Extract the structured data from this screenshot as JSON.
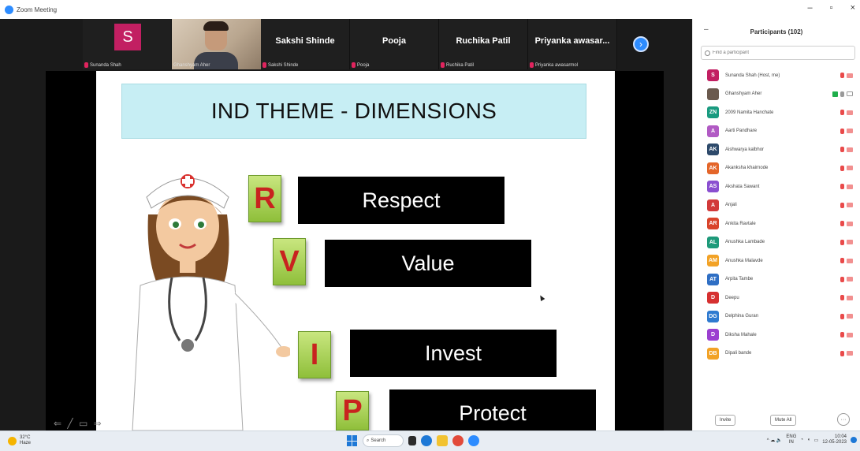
{
  "window": {
    "title": "Zoom Meeting",
    "controls": [
      "–",
      "▫",
      "×"
    ]
  },
  "video_strip": {
    "tiles": [
      {
        "type": "avatar",
        "initial": "S",
        "label": "Sunanda Shah"
      },
      {
        "type": "video",
        "label": "Ghanshyam Aher"
      },
      {
        "type": "name",
        "name": "Sakshi Shinde",
        "label": "Sakshi Shinde"
      },
      {
        "type": "name",
        "name": "Pooja",
        "label": "Pooja"
      },
      {
        "type": "name",
        "name": "Ruchika Patil",
        "label": "Ruchika Patil"
      },
      {
        "type": "name",
        "name": "Priyanka awasar...",
        "label": "Priyanka awasarmol"
      }
    ],
    "next_icon": "›"
  },
  "slide": {
    "title": "IND THEME - DIMENSIONS",
    "items": [
      {
        "letter": "R",
        "word": "Respect"
      },
      {
        "letter": "V",
        "word": "Value"
      },
      {
        "letter": "I",
        "word": "Invest"
      },
      {
        "letter": "P",
        "word": "Protect"
      }
    ],
    "tools": "⇐ ╱ ▭ ⇒"
  },
  "participants": {
    "collapse_icon": "–",
    "title": "Participants (102)",
    "search_placeholder": "Find a participant",
    "list": [
      {
        "initials": "S",
        "name": "Sunanda Shah (Host, me)",
        "color": "#c21f62",
        "status": "muted"
      },
      {
        "initials": "",
        "name": "Ghanshyam Aher",
        "color": "#6b5a4e",
        "status": "active"
      },
      {
        "initials": "ZN",
        "name": "2009 Namita Hanchate",
        "color": "#1a9b80",
        "status": "muted"
      },
      {
        "initials": "A",
        "name": "Aarti Pandhare",
        "color": "#b15ac4",
        "status": "muted"
      },
      {
        "initials": "AK",
        "name": "Aishwarya kalbhor",
        "color": "#2e4a6b",
        "status": "muted"
      },
      {
        "initials": "AK",
        "name": "Akanksha khairnode",
        "color": "#e4662a",
        "status": "muted"
      },
      {
        "initials": "AS",
        "name": "Akshata Sawant",
        "color": "#8a4fd0",
        "status": "muted"
      },
      {
        "initials": "A",
        "name": "Anjali",
        "color": "#d23a3a",
        "status": "muted"
      },
      {
        "initials": "AR",
        "name": "Ankita Ravtale",
        "color": "#d9442b",
        "status": "muted"
      },
      {
        "initials": "AL",
        "name": "Anushka Lambade",
        "color": "#1e9a7a",
        "status": "muted"
      },
      {
        "initials": "AM",
        "name": "Anushka Malavde",
        "color": "#f2a226",
        "status": "muted"
      },
      {
        "initials": "AT",
        "name": "Arpita Tambe",
        "color": "#2f6fc4",
        "status": "muted"
      },
      {
        "initials": "D",
        "name": "Deepu",
        "color": "#d63030",
        "status": "muted"
      },
      {
        "initials": "DG",
        "name": "Delphina Guran",
        "color": "#2f7ad0",
        "status": "muted"
      },
      {
        "initials": "D",
        "name": "Diksha Mahale",
        "color": "#9b3fd0",
        "status": "muted"
      },
      {
        "initials": "DB",
        "name": "Dipali bande",
        "color": "#f2a226",
        "status": "muted"
      }
    ],
    "invite_label": "Invite",
    "mute_all_label": "Mute All",
    "more_label": "···"
  },
  "taskbar": {
    "weather_temp": "32°C",
    "weather_desc": "Haze",
    "search_label": "Search",
    "lang": "ENG",
    "region": "IN",
    "time": "10:04",
    "date": "12-05-2023",
    "tray": "^ ☁ 🔈"
  }
}
